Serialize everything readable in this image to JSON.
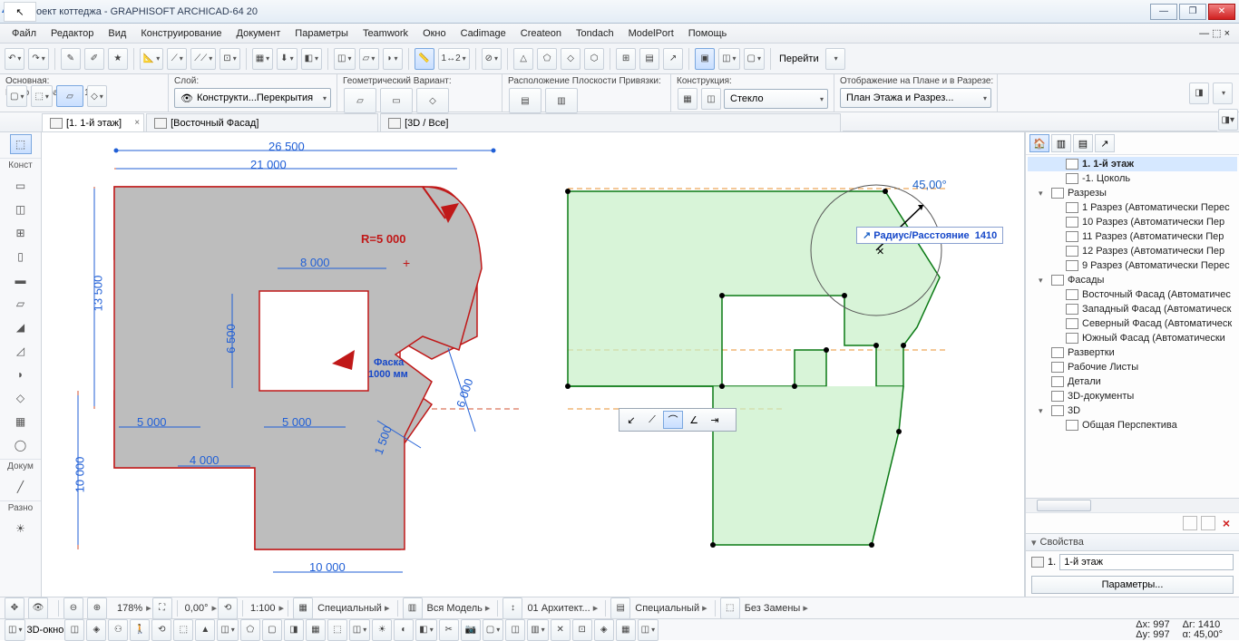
{
  "title": "Проект коттеджа - GRAPHISOFT ARCHICAD-64 20",
  "menu": [
    "Файл",
    "Редактор",
    "Вид",
    "Конструирование",
    "Документ",
    "Параметры",
    "Teamwork",
    "Окно",
    "Cadimage",
    "Createon",
    "Tondach",
    "ModelPort",
    "Помощь"
  ],
  "ribbon": {
    "goto": "Перейти"
  },
  "info": {
    "basic": {
      "lbl": "Основная:",
      "sub": "Всего выбранных: 1"
    },
    "layer": {
      "lbl": "Слой:",
      "val": "Конструкти...Перекрытия"
    },
    "geom": {
      "lbl": "Геометрический Вариант:"
    },
    "plane": {
      "lbl": "Расположение Плоскости Привязки:"
    },
    "constr": {
      "lbl": "Конструкция:",
      "val": "Стекло"
    },
    "display": {
      "lbl": "Отображение на Плане и в Разрезе:",
      "val": "План Этажа и Разрез..."
    }
  },
  "tabs": [
    {
      "label": "[1. 1-й этаж]",
      "icon": "plan",
      "active": true
    },
    {
      "label": "[Восточный Фасад]",
      "icon": "elev"
    },
    {
      "label": "[3D / Все]",
      "icon": "3d"
    }
  ],
  "side": {
    "sec1": "Конст",
    "sec2": "Докум",
    "sec3": "Разно"
  },
  "dims": {
    "d26500": "26 500",
    "d21000": "21 000",
    "r5000": "R=5 000",
    "d8000": "8 000",
    "d13500": "13 500",
    "d6500": "6 500",
    "faska": "Фаска",
    "faska2": "1000 мм",
    "d6000": "6 000",
    "d5000a": "5 000",
    "d5000b": "5 000",
    "d1500": "1 500",
    "d4000": "4 000",
    "d10000a": "10 000",
    "d10000b": "10 000",
    "ang": "45,00°"
  },
  "tooltip": {
    "label": "Радиус/Расстояние",
    "val": "1410"
  },
  "tree": [
    {
      "lvl": 1,
      "label": "1. 1-й этаж",
      "bold": true,
      "sel": true,
      "ic": "plan"
    },
    {
      "lvl": 1,
      "label": "-1. Цоколь",
      "ic": "plan"
    },
    {
      "lvl": 0,
      "label": "Разрезы",
      "tw": "▾",
      "ic": "section"
    },
    {
      "lvl": 1,
      "label": "1 Разрез (Автоматически Перес",
      "ic": "sec"
    },
    {
      "lvl": 1,
      "label": "10 Разрез (Автоматически Пер",
      "ic": "sec"
    },
    {
      "lvl": 1,
      "label": "11 Разрез (Автоматически Пер",
      "ic": "sec"
    },
    {
      "lvl": 1,
      "label": "12 Разрез (Автоматически Пер",
      "ic": "sec"
    },
    {
      "lvl": 1,
      "label": "9 Разрез (Автоматически Перес",
      "ic": "sec"
    },
    {
      "lvl": 0,
      "label": "Фасады",
      "tw": "▾",
      "ic": "elev"
    },
    {
      "lvl": 1,
      "label": "Восточный Фасад (Автоматичес",
      "ic": "el"
    },
    {
      "lvl": 1,
      "label": "Западный Фасад (Автоматическ",
      "ic": "el"
    },
    {
      "lvl": 1,
      "label": "Северный Фасад (Автоматическ",
      "ic": "el"
    },
    {
      "lvl": 1,
      "label": "Южный Фасад (Автоматически",
      "ic": "el"
    },
    {
      "lvl": 0,
      "label": "Развертки",
      "tw": "",
      "ic": "int"
    },
    {
      "lvl": 0,
      "label": "Рабочие Листы",
      "tw": "",
      "ic": "ws"
    },
    {
      "lvl": 0,
      "label": "Детали",
      "tw": "",
      "ic": "det"
    },
    {
      "lvl": 0,
      "label": "3D-документы",
      "tw": "",
      "ic": "3dd"
    },
    {
      "lvl": 0,
      "label": "3D",
      "tw": "▾",
      "ic": "3d"
    },
    {
      "lvl": 1,
      "label": "Общая Перспектива",
      "ic": "persp"
    }
  ],
  "props": {
    "hdr": "Свойства",
    "rowlbl": "1.",
    "rowval": "1-й этаж",
    "btn": "Параметры..."
  },
  "status": {
    "zoom": "178%",
    "rot": "0,00°",
    "scale": "1:100",
    "opt1": "Специальный",
    "opt2": "Вся Модель",
    "opt3": "01 Архитект...",
    "opt4": "Специальный",
    "opt5": "Без Замены",
    "win3d": "3D-окно",
    "dx": "Δx: 997",
    "dy": "Δy: 997",
    "dr": "Δr: 1410",
    "da": "α: 45,00°"
  }
}
